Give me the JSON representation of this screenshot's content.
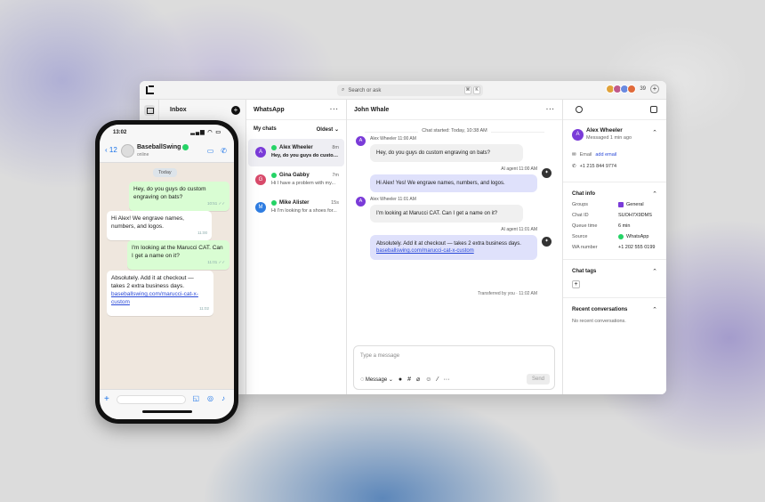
{
  "app": {
    "search_placeholder": "Search or ask",
    "kbd1": "⌘",
    "kbd2": "K",
    "avatar_count": "39",
    "inbox_title": "Inbox",
    "list_title": "WhatsApp",
    "filter_label": "My chats",
    "sort_label": "Oldest",
    "conversations": [
      {
        "initial": "A",
        "name": "Alex Wheeler",
        "time": "8m",
        "preview": "Hey, do you guys do custom...",
        "color": "#7a3bd8"
      },
      {
        "initial": "G",
        "name": "Gina Gabby",
        "time": "7m",
        "preview": "Hi I have a problem with my...",
        "color": "#d84a6a"
      },
      {
        "initial": "M",
        "name": "Mike Alister",
        "time": "15s",
        "preview": "Hi I'm looking for a shoes for...",
        "color": "#2f7de1"
      }
    ],
    "chat_title": "John Whale",
    "chat_started": "Chat started: Today, 10:38 AM",
    "messages": [
      {
        "who": "Alex Wheeler 11:00 AM",
        "text": "Hey, do you guys do custom engraving on bats?"
      },
      {
        "who": "AI agent 11:00 AM",
        "text": "Hi Alex! Yes! We engrave names, numbers, and logos."
      },
      {
        "who": "Alex Wheeler 11:01 AM",
        "text": "I'm looking at Marucci CAT. Can I get a name on it?"
      },
      {
        "who": "AI agent 11:01 AM",
        "text": "Absolutely. Add it at checkout — takes 2 extra business days.",
        "link": "baseballswing.com/marucci-cat-x-custom"
      }
    ],
    "transfer_note": "Transferred by you · 11:02 AM",
    "composer_placeholder": "Type a message",
    "composer_mode": "Message",
    "send_label": "Send",
    "contact": {
      "initial": "A",
      "name": "Alex Wheeler",
      "sub": "Messaged 1 min ago",
      "email_label": "Email",
      "email_action": "add email",
      "phone": "+1 215 844 9774"
    },
    "chat_info": {
      "title": "Chat info",
      "rows": [
        {
          "k": "Groups",
          "v": "General"
        },
        {
          "k": "Chat ID",
          "v": "SUOH7X9DMS"
        },
        {
          "k": "Queue time",
          "v": "6 min"
        },
        {
          "k": "Source",
          "v": "WhatsApp"
        },
        {
          "k": "WA number",
          "v": "+1 202 555 0199"
        }
      ]
    },
    "chat_tags_title": "Chat tags",
    "recent_title": "Recent conversations",
    "recent_empty": "No recent conversations."
  },
  "phone": {
    "time": "13:02",
    "back_count": "12",
    "name": "BaseballSwing",
    "status": "online",
    "day": "Today",
    "bubbles": [
      {
        "dir": "out",
        "text": "Hey, do you guys do custom engraving on bats?",
        "meta": "10:51 ✓✓"
      },
      {
        "dir": "in",
        "text": "Hi Alex! We engrave names, numbers, and logos.",
        "meta": "11:00"
      },
      {
        "dir": "out",
        "text": "I'm looking at the Marucci CAT. Can I get a name on it?",
        "meta": "11:01 ✓✓"
      },
      {
        "dir": "in",
        "text": "Absolutely. Add it at checkout — takes 2 extra business days.",
        "link": "baseballswing.com/marucci-cat-x-custom",
        "meta": "11:02"
      }
    ]
  },
  "colors": {
    "accent": "#2b4ad8",
    "whatsapp": "#25d366",
    "ai_bubble": "#dfe1fb",
    "phone_out": "#d9fdd3"
  }
}
